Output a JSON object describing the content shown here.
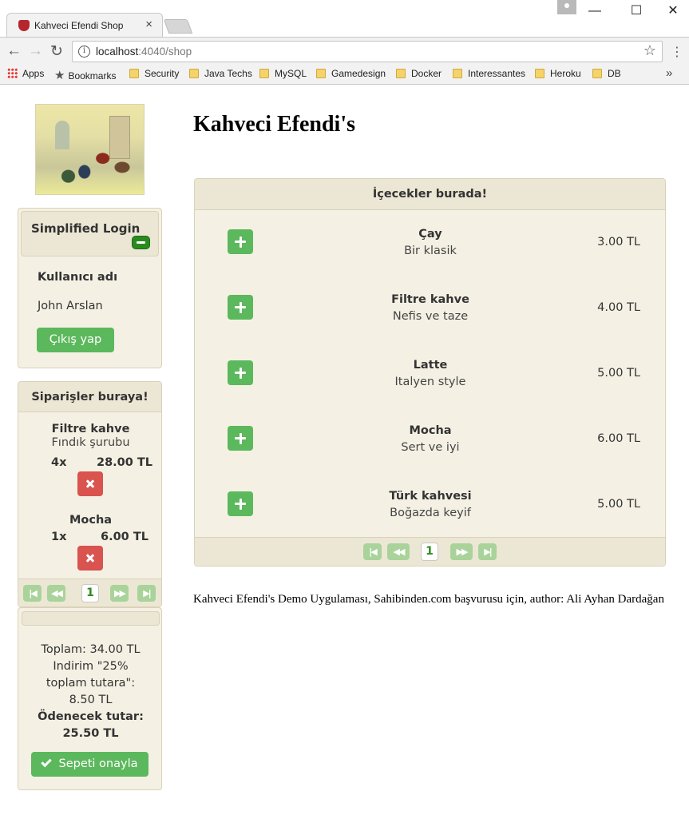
{
  "browser": {
    "tab_title": "Kahveci Efendi Shop",
    "tab_close": "×",
    "window_controls": {
      "minimize": "—",
      "maximize": "☐",
      "close": "✕"
    },
    "url_host": "localhost",
    "url_path": ":4040/shop",
    "bookmarks": [
      {
        "label": "Apps",
        "icon": "apps-grid-icon"
      },
      {
        "label": "Bookmarks",
        "icon": "star-icon"
      },
      {
        "label": "Security",
        "icon": "folder-icon"
      },
      {
        "label": "Java Techs",
        "icon": "folder-icon"
      },
      {
        "label": "MySQL",
        "icon": "folder-icon"
      },
      {
        "label": "Gamedesign",
        "icon": "folder-icon"
      },
      {
        "label": "Docker",
        "icon": "folder-icon"
      },
      {
        "label": "Interessantes",
        "icon": "folder-icon"
      },
      {
        "label": "Heroku",
        "icon": "folder-icon"
      },
      {
        "label": "DB",
        "icon": "folder-icon"
      }
    ],
    "bookmarks_more": "»"
  },
  "login": {
    "title": "Simplified Login",
    "username_label": "Kullanıcı adı",
    "username": "John Arslan",
    "logout_label": "Çıkış yap"
  },
  "orders": {
    "title": "Siparişler buraya!",
    "items": [
      {
        "name": "Filtre kahve",
        "extra": "Fındık şurubu",
        "qty": "4x",
        "price": "28.00 TL"
      },
      {
        "name": "Mocha",
        "extra": "",
        "qty": "1x",
        "price": "6.00 TL"
      }
    ],
    "pager": {
      "first": "|◀",
      "prev": "◀◀",
      "page": "1",
      "next": "▶▶",
      "last": "▶|"
    }
  },
  "totals": {
    "total": "Toplam: 34.00 TL",
    "discount": "Indirim \"25% toplam tutara\": 8.50 TL",
    "payable_label": "Ödenecek tutar:",
    "payable_value": "25.50 TL",
    "confirm_label": "Sepeti onayla"
  },
  "page": {
    "title": "Kahveci Efendi's"
  },
  "menu": {
    "title": "İçecekler burada!",
    "items": [
      {
        "name": "Çay",
        "desc": "Bir klasik",
        "price": "3.00 TL"
      },
      {
        "name": "Filtre kahve",
        "desc": "Nefis ve taze",
        "price": "4.00 TL"
      },
      {
        "name": "Latte",
        "desc": "Italyen style",
        "price": "5.00 TL"
      },
      {
        "name": "Mocha",
        "desc": "Sert ve iyi",
        "price": "6.00 TL"
      },
      {
        "name": "Türk kahvesi",
        "desc": "Boğazda keyif",
        "price": "5.00 TL"
      }
    ],
    "pager": {
      "first": "|◀",
      "prev": "◀◀",
      "page": "1",
      "next": "▶▶",
      "last": "▶|"
    }
  },
  "footer": {
    "text": "Kahveci Efendi's Demo Uygulaması, Sahibinden.com başvurusu için, author: Ali Ayhan Dardağan"
  },
  "colors": {
    "success": "#5cb85c",
    "danger": "#d9534f",
    "panel_bg": "#f4f1e4",
    "panel_head": "#ece7d4"
  }
}
